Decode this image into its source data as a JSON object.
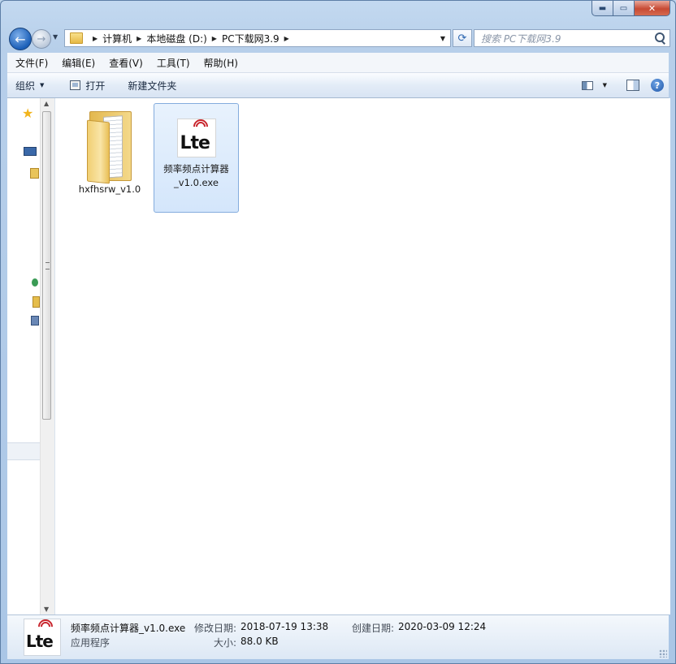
{
  "window": {
    "caption": {
      "minimize": "▬",
      "maximize": "▭",
      "close": "✕"
    }
  },
  "address_bar": {
    "crumbs": [
      "计算机",
      "本地磁盘 (D:)",
      "PC下载网3.9"
    ],
    "search_placeholder": "搜索 PC下载网3.9"
  },
  "menu": [
    "文件(F)",
    "编辑(E)",
    "查看(V)",
    "工具(T)",
    "帮助(H)"
  ],
  "toolbar": {
    "organize": "组织",
    "open": "打开",
    "new_folder": "新建文件夹"
  },
  "files": [
    {
      "name": "hxfhsrw_v1.0",
      "type": "folder",
      "selected": false
    },
    {
      "name_line1": "频率频点计算器",
      "name_line2": "_v1.0.exe",
      "type": "exe",
      "selected": true,
      "icon_text": "Lte"
    }
  ],
  "details": {
    "name": "频率频点计算器_v1.0.exe",
    "type": "应用程序",
    "modified_label": "修改日期:",
    "modified_value": "2018-07-19 13:38",
    "created_label": "创建日期:",
    "created_value": "2020-03-09 12:24",
    "size_label": "大小:",
    "size_value": "88.0 KB",
    "icon_text": "Lte"
  },
  "colors": {
    "selection": "#d4e6fb",
    "selection_border": "#84acdd",
    "accent": "#1b5fb8"
  }
}
